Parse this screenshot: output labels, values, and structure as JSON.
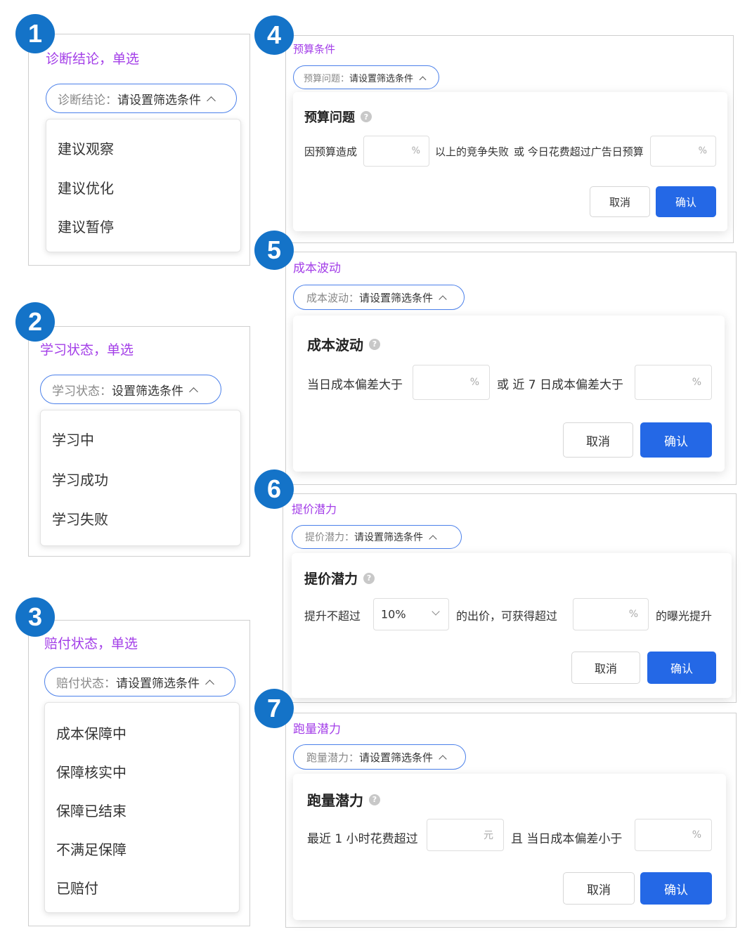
{
  "badges": [
    "1",
    "2",
    "3",
    "4",
    "5",
    "6",
    "7"
  ],
  "colors": {
    "badge": "#1473c8",
    "title": "#a33ee8",
    "primary": "#2468e6",
    "pill_border": "#4b80ea"
  },
  "icons": {
    "help": "question-circle-icon",
    "chevron_up": "chevron-up-icon",
    "chevron_down": "chevron-down-icon"
  },
  "p1": {
    "title": "诊断结论，单选",
    "pill_label": "诊断结论：",
    "pill_value": "请设置筛选条件",
    "options": [
      "建议观察",
      "建议优化",
      "建议暂停"
    ]
  },
  "p2": {
    "title": "学习状态，单选",
    "pill_label": "学习状态：",
    "pill_value": "设置筛选条件",
    "options": [
      "学习中",
      "学习成功",
      "学习失败"
    ]
  },
  "p3": {
    "title": "赔付状态，单选",
    "pill_label": "赔付状态：",
    "pill_value": "请设置筛选条件",
    "options": [
      "成本保障中",
      "保障核实中",
      "保障已结束",
      "不满足保障",
      "已赔付"
    ]
  },
  "p4": {
    "title": "预算条件",
    "pill_label": "预算问题：",
    "pill_value": "请设置筛选条件",
    "card_title": "预算问题",
    "t1": "因预算造成",
    "unit1": "%",
    "t2": "以上的竞争失败",
    "t3": "或 今日花费超过广告日预算",
    "unit2": "%",
    "cancel": "取消",
    "ok": "确认"
  },
  "p5": {
    "title": "成本波动",
    "pill_label": "成本波动：",
    "pill_value": "请设置筛选条件",
    "card_title": "成本波动",
    "t1": "当日成本偏差大于",
    "unit1": "%",
    "t2": "或 近 7 日成本偏差大于",
    "unit2": "%",
    "cancel": "取消",
    "ok": "确认"
  },
  "p6": {
    "title": "提价潜力",
    "pill_label": "提价潜力：",
    "pill_value": "请设置筛选条件",
    "card_title": "提价潜力",
    "t1": "提升不超过",
    "select_value": "10%",
    "t2": "的出价，可获得超过",
    "unit1": "%",
    "t3": "的曝光提升",
    "cancel": "取消",
    "ok": "确认"
  },
  "p7": {
    "title": "跑量潜力",
    "pill_label": "跑量潜力：",
    "pill_value": "请设置筛选条件",
    "card_title": "跑量潜力",
    "t1": "最近 1 小时花费超过",
    "unit1": "元",
    "t2": "且 当日成本偏差小于",
    "unit2": "%",
    "cancel": "取消",
    "ok": "确认"
  }
}
